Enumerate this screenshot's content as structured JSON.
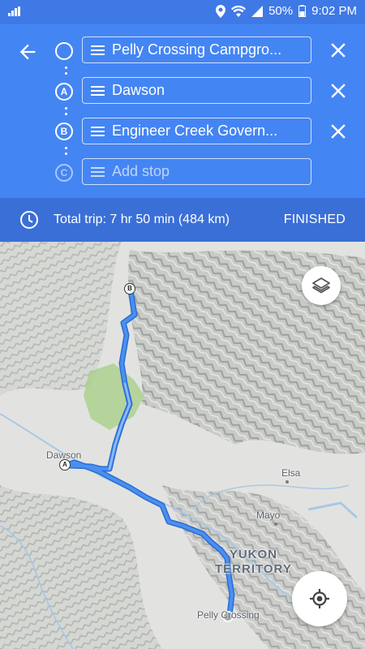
{
  "status_bar": {
    "battery": "50%",
    "time": "9:02 PM"
  },
  "directions": {
    "stops": [
      {
        "marker": "",
        "text": "Pelly Crossing Campgro..."
      },
      {
        "marker": "A",
        "text": "Dawson"
      },
      {
        "marker": "B",
        "text": "Engineer Creek Govern..."
      }
    ],
    "add_stop": {
      "marker": "C",
      "placeholder": "Add stop"
    }
  },
  "trip": {
    "summary": "Total trip: 7 hr 50 min  (484 km)",
    "finished_label": "FINISHED"
  },
  "map": {
    "labels": {
      "dawson": "Dawson",
      "elsa": "Elsa",
      "mayo": "Mayo",
      "pelly": "Pelly Crossing",
      "region_line1": "YUKON",
      "region_line2": "TERRITORY"
    },
    "pins": {
      "a": "A",
      "b": "B"
    },
    "route_color": "#4a90ee"
  },
  "colors": {
    "header": "#4485f4",
    "trip_bar": "#3a6fd8",
    "status_bar": "#3f79e6"
  }
}
